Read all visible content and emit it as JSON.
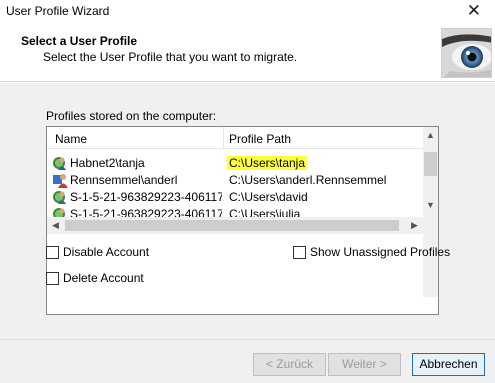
{
  "window": {
    "title": "User Profile Wizard",
    "close_glyph": "✕"
  },
  "header": {
    "title": "Select a User Profile",
    "subtitle": "Select the User Profile that you want to migrate."
  },
  "profiles": {
    "label": "Profiles stored on the computer:",
    "columns": [
      "Name",
      "Profile Path"
    ],
    "rows": [
      {
        "name": "Habnet2\\tanja",
        "path": "C:\\Users\\tanja",
        "icon": "domain-user-icon",
        "highlighted": true
      },
      {
        "name": "Rennsemmel\\anderl",
        "path": "C:\\Users\\anderl.Rennsemmel",
        "icon": "local-user-icon",
        "highlighted": false
      },
      {
        "name": "S-1-5-21-963829223-4061179...",
        "path": "C:\\Users\\david",
        "icon": "domain-user-icon",
        "highlighted": false
      },
      {
        "name": "S-1-5-21-963829223-4061179...",
        "path": "C:\\Users\\julia",
        "icon": "domain-user-icon",
        "highlighted": false
      }
    ]
  },
  "options": {
    "disable_account": "Disable Account",
    "delete_account": "Delete Account",
    "show_unassigned": "Show Unassigned Profiles"
  },
  "buttons": {
    "back": "< Zurück",
    "next": "Weiter >",
    "cancel": "Abbrechen"
  },
  "colors": {
    "highlight": "#ffff3c",
    "accent": "#0078d7"
  }
}
